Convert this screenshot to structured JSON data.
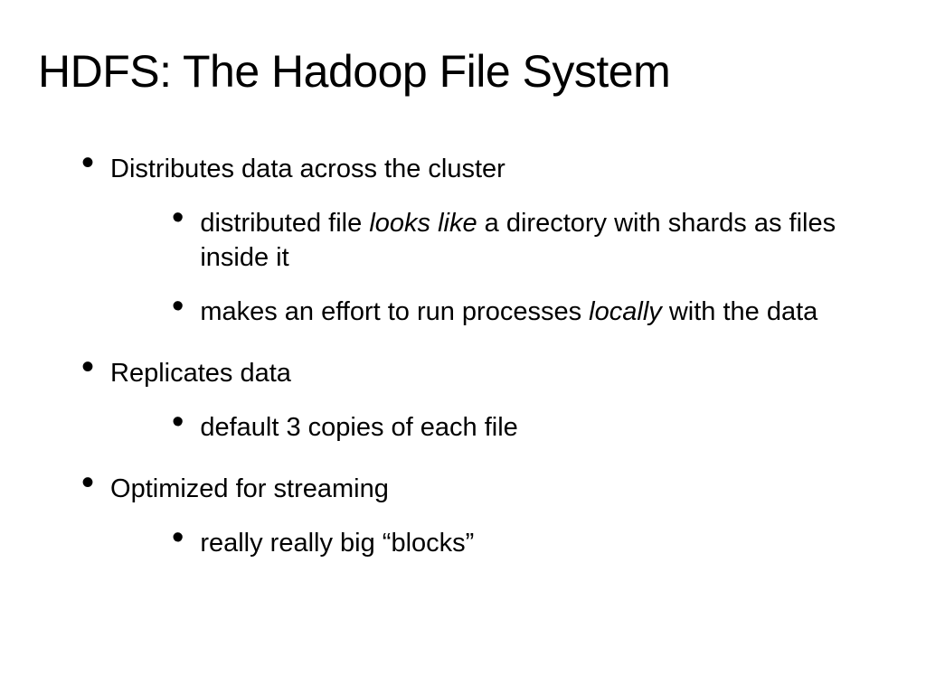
{
  "title": "HDFS: The Hadoop File System",
  "bullets": {
    "b1": {
      "text": "Distributes data across the cluster",
      "sub": {
        "s1": {
          "pre": "distributed file ",
          "italic": "looks like",
          "post": " a directory with shards as files inside it"
        },
        "s2": {
          "pre": "makes an effort to run processes ",
          "italic": "locally",
          "post": " with the data"
        }
      }
    },
    "b2": {
      "text": "Replicates data",
      "sub": {
        "s1": {
          "text": "default 3 copies of each file"
        }
      }
    },
    "b3": {
      "text": "Optimized for streaming",
      "sub": {
        "s1": {
          "text": "really really big “blocks”"
        }
      }
    }
  }
}
